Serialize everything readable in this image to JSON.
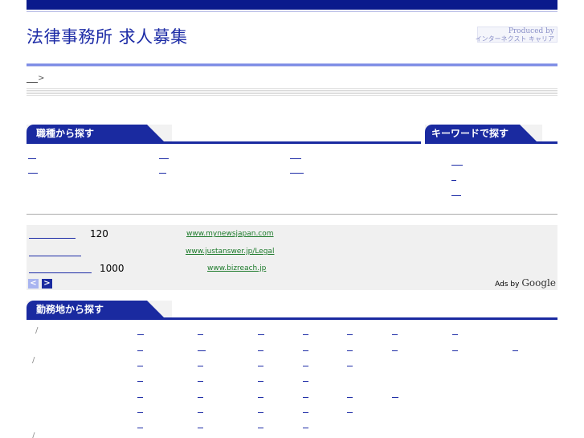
{
  "site": {
    "title": "法律事務所 求人募集",
    "produced_line1": "Produced by",
    "produced_line2": "インターネクスト キャリア"
  },
  "breadcrumb": {
    "separator": ">"
  },
  "sections": {
    "job_type": {
      "heading": "職種から探す"
    },
    "keyword": {
      "heading": "キーワードで探す"
    },
    "location": {
      "heading": "勤務地から探す"
    }
  },
  "ads": {
    "items": [
      {
        "number": "120",
        "url": "www.mynewsjapan.com"
      },
      {
        "number": "",
        "url": "www.justanswer.jp/Legal"
      },
      {
        "number": "1000",
        "url": "www.bizreach.jp"
      }
    ],
    "prev_label": "<",
    "next_label": ">",
    "ads_by": "Ads by",
    "google": "Google"
  },
  "location_slashes": [
    "/",
    "/",
    "/"
  ]
}
